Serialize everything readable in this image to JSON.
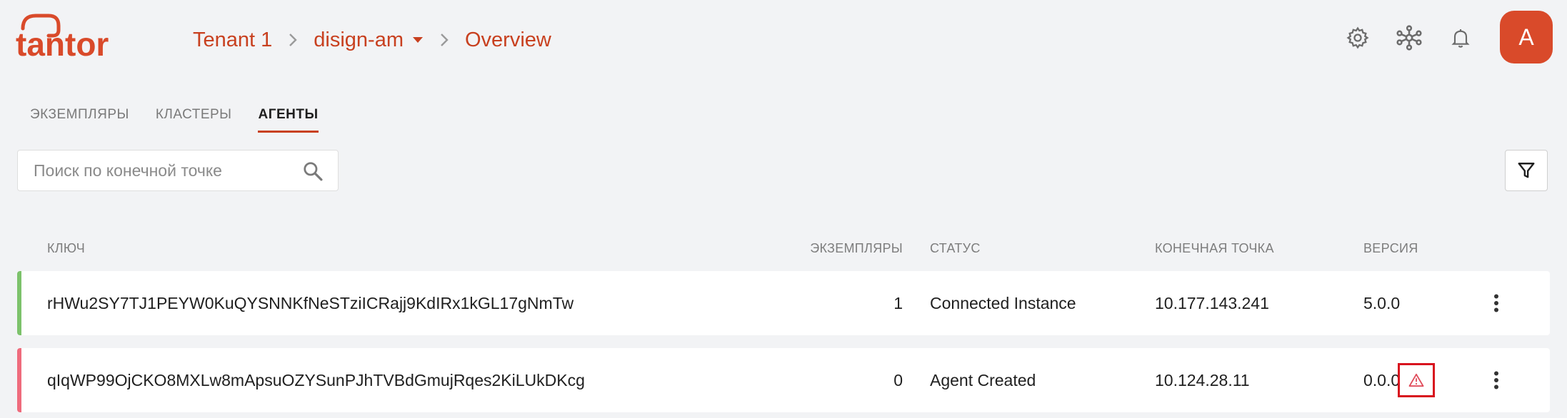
{
  "brand": {
    "logo_text": "tantor",
    "accent_color": "#c8401f"
  },
  "header": {
    "breadcrumb": [
      {
        "label": "Tenant 1"
      },
      {
        "label": "disign-am",
        "dropdown": true
      },
      {
        "label": "Overview"
      }
    ],
    "icons": [
      "gear-icon",
      "cluster-network-icon",
      "bell-icon"
    ],
    "avatar_letter": "A"
  },
  "tabs": [
    {
      "label": "ЭКЗЕМПЛЯРЫ",
      "active": false
    },
    {
      "label": "КЛАСТЕРЫ",
      "active": false
    },
    {
      "label": "АГЕНТЫ",
      "active": true
    }
  ],
  "search": {
    "placeholder": "Поиск по конечной точке",
    "value": ""
  },
  "table": {
    "columns": {
      "key": "КЛЮЧ",
      "instances": "ЭКЗЕМПЛЯРЫ",
      "status": "СТАТУС",
      "endpoint": "КОНЕЧНАЯ ТОЧКА",
      "version": "ВЕРСИЯ"
    },
    "rows": [
      {
        "key": "rHWu2SY7TJ1PEYW0KuQYSNNKfNeSTziICRajj9KdIRx1kGL17gNmTw",
        "instances": "1",
        "status": "Connected Instance",
        "endpoint": "10.177.143.241",
        "version": "5.0.0",
        "status_color": "#7cc26b",
        "warning": false
      },
      {
        "key": "qIqWP99OjCKO8MXLw8mApsuOZYSunPJhTVBdGmujRqes2KiLUkDKcg",
        "instances": "0",
        "status": "Agent Created",
        "endpoint": "10.124.28.11",
        "version": "0.0.0",
        "status_color": "#ef6b7c",
        "warning": true
      }
    ]
  }
}
